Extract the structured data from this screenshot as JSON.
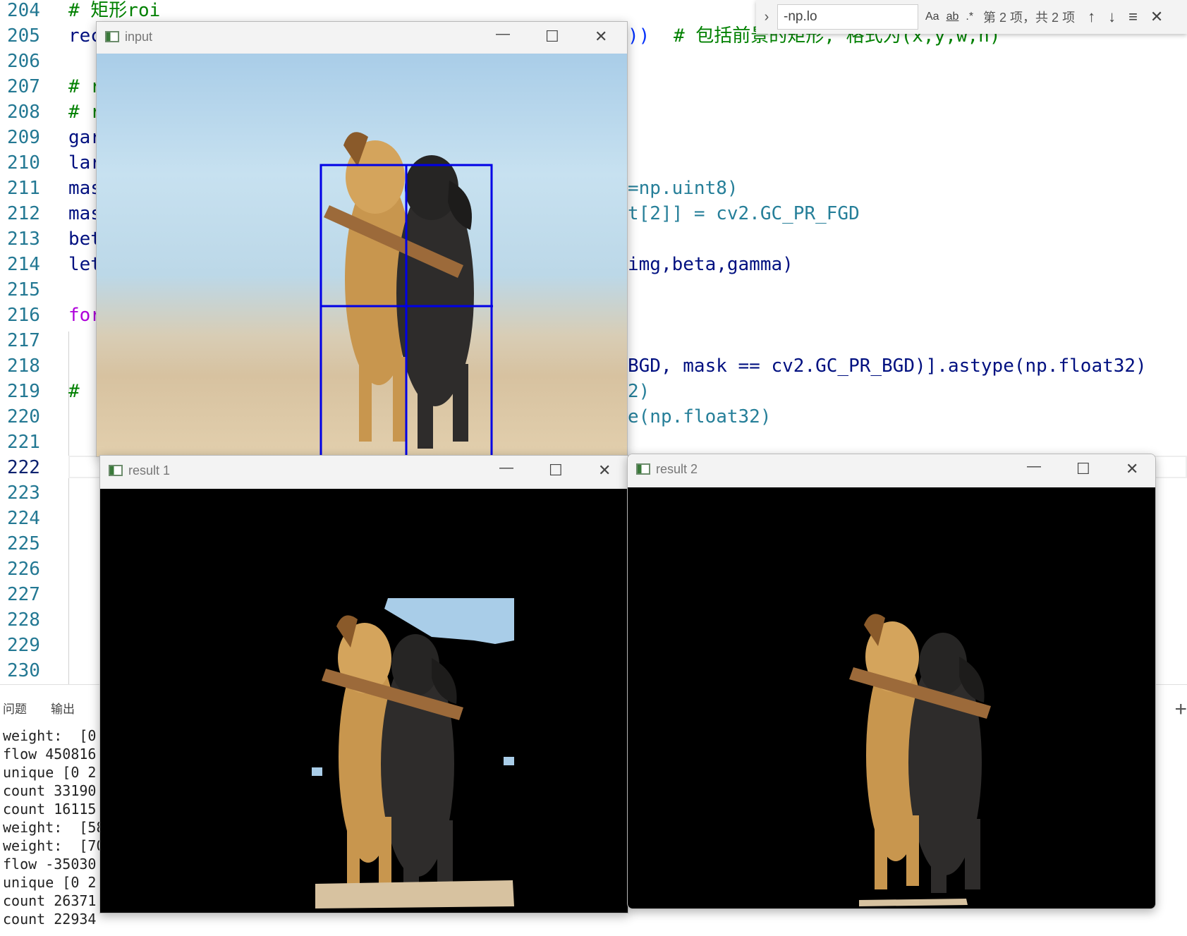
{
  "editor": {
    "line_numbers": [
      "204",
      "205",
      "206",
      "207",
      "208",
      "209",
      "210",
      "211",
      "212",
      "213",
      "214",
      "215",
      "216",
      "217",
      "218",
      "219",
      "220",
      "221",
      "222",
      "223",
      "224",
      "225",
      "226",
      "227",
      "228",
      "229",
      "230"
    ],
    "active_line": "222",
    "lines": {
      "l204": "# 矩形roi",
      "l205_a": "rec",
      "l205_b": "))",
      "l205_c": "# 包括前景的矩形, 格式为(x,y,w,h)",
      "l207": "# r",
      "l208": "# r",
      "l209": "gar",
      "l210": "lar",
      "l211_a": "mas",
      "l211_b": "=np.uint8)",
      "l212_a": "mas",
      "l212_b": "t[2]] = cv2.GC_PR_FGD",
      "l213": "bet",
      "l214_a": "let",
      "l214_b": "img,beta,gamma)",
      "l216": "for",
      "l218": "BGD, mask == cv2.GC_PR_BGD)].astype(np.float32)",
      "l219_a": "#",
      "l219_b": "2)",
      "l220": "e(np.float32)"
    }
  },
  "find_widget": {
    "query": "-np.lo",
    "match_case": "Aa",
    "whole_word": "ab",
    "regex": ".*",
    "result": "第 2 项，共 2 项",
    "prev_icon": "arrow-up-icon",
    "next_icon": "arrow-down-icon",
    "selection_icon": "menu-icon",
    "close_icon": "close-icon"
  },
  "panel": {
    "tabs": [
      "问题",
      "输出"
    ],
    "terminal_lines": [
      "weight:  [0",
      "flow 450816",
      "unique [0 2",
      "count 33190",
      "count 16115",
      "weight:  [58",
      "weight:  [70",
      "flow -35030",
      "unique [0 2",
      "count 26371",
      "count 22934"
    ]
  },
  "windows": {
    "input_title": "input",
    "result1_title": "result 1",
    "result2_title": "result 2",
    "minimize": "—",
    "maximize": "☐",
    "close": "✕"
  },
  "colors": {
    "roi_rect": "#0000e6",
    "comment": "#008000",
    "keyword": "#af00db"
  }
}
